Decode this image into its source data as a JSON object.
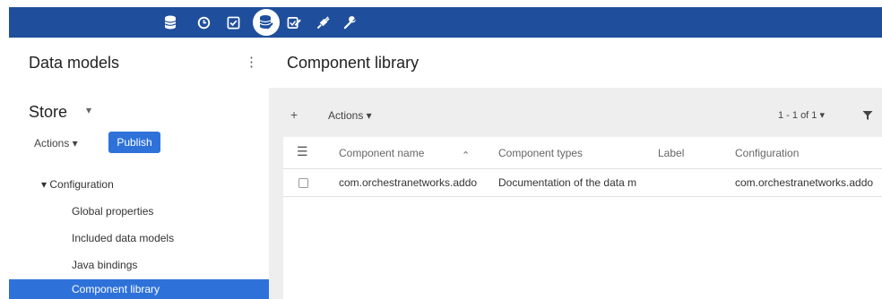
{
  "toolbar": {
    "icons": [
      "database-icon",
      "clock-icon",
      "checklist-icon",
      "data-model-icon",
      "edit-check-icon",
      "plug-icon",
      "wrench-icon"
    ]
  },
  "left_panel": {
    "title": "Data models",
    "kebab": "⋮",
    "store_label": "Store",
    "store_chevron": "▾",
    "actions_label": "Actions ▾",
    "publish_label": "Publish",
    "tree": {
      "configuration": "▾ Configuration",
      "items": [
        "Global properties",
        "Included data models",
        "Java bindings",
        "Component library"
      ]
    }
  },
  "right_panel": {
    "title": "Component library",
    "add_label": "+",
    "actions_label": "Actions ▾",
    "pager": "1 - 1 of 1 ▾",
    "table": {
      "menu_icon": "☰",
      "columns": [
        "Component name",
        "Component types",
        "Label",
        "Configuration"
      ],
      "sort_indicator": "⌃",
      "rows": [
        [
          "com.orchestranetworks.addo",
          "Documentation of the data m",
          "",
          "com.orchestranetworks.addo"
        ]
      ]
    }
  },
  "colors": {
    "topbar": "#1f4f9c",
    "accent": "#2e72d9",
    "right_background": "#eeeeee"
  }
}
